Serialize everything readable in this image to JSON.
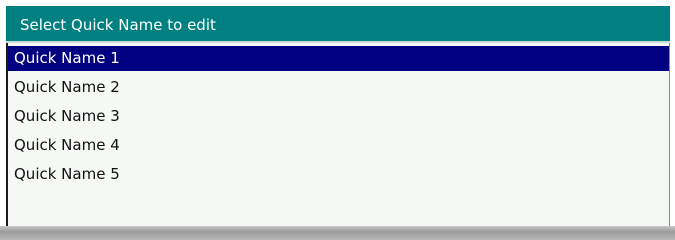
{
  "dialog": {
    "title": "Select Quick Name to edit"
  },
  "list": {
    "selected_index": 0,
    "items": [
      {
        "label": "Quick Name 1"
      },
      {
        "label": "Quick Name 2"
      },
      {
        "label": "Quick Name 3"
      },
      {
        "label": "Quick Name 4"
      },
      {
        "label": "Quick Name 5"
      }
    ]
  },
  "colors": {
    "titlebar": "#008080",
    "selection": "#000080",
    "list_background": "#f5f8f5"
  }
}
